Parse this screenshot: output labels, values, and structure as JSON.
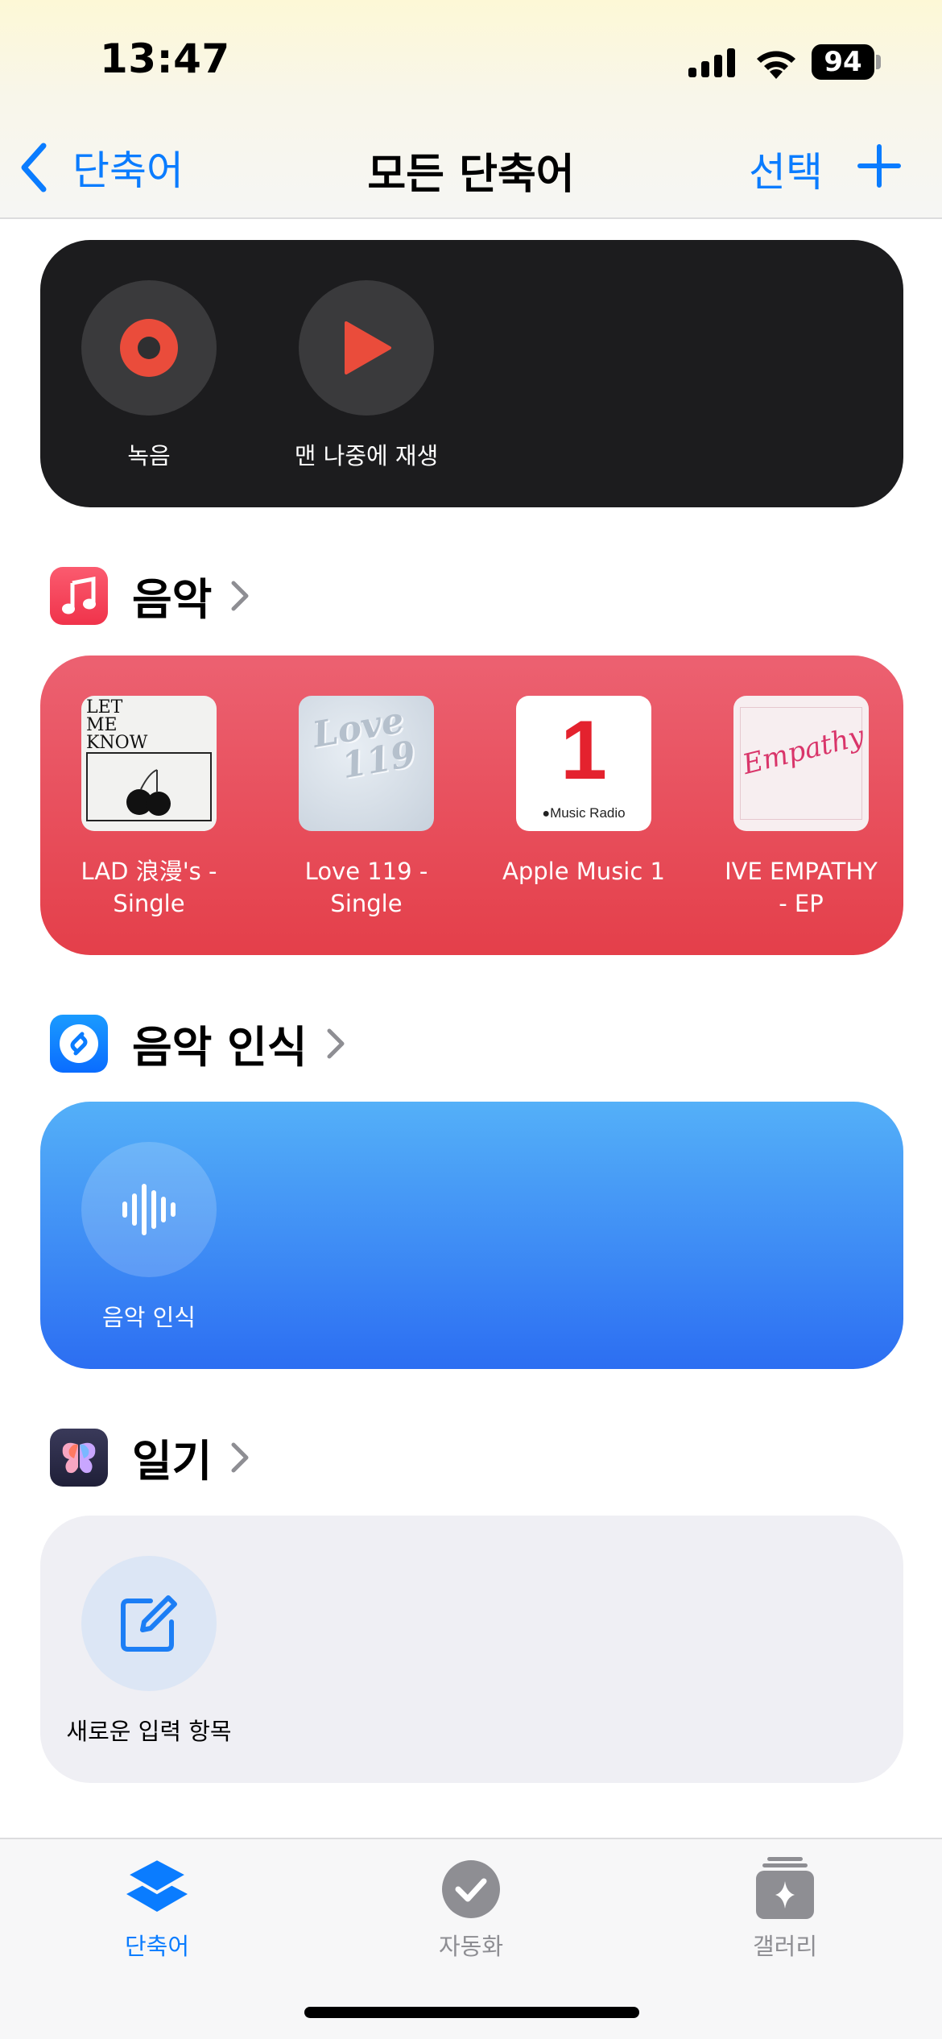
{
  "status_bar": {
    "time": "13:47",
    "battery": "94"
  },
  "nav": {
    "back_label": "단축어",
    "title": "모든 단축어",
    "select_label": "선택"
  },
  "voice_memo_card": {
    "items": [
      {
        "label": "녹음",
        "icon": "record-icon"
      },
      {
        "label": "맨 나중에 재생",
        "icon": "play-icon"
      }
    ]
  },
  "music_section": {
    "title": "음악",
    "items": [
      {
        "line1": "LAD 浪漫's -",
        "line2": "Single",
        "art_text": [
          "LET",
          "ME",
          "KNOW"
        ]
      },
      {
        "line1": "Love 119 -",
        "line2": "Single",
        "art_text": [
          "Love",
          "119"
        ]
      },
      {
        "line1": "Apple Music 1",
        "line2": "",
        "art_number": "1",
        "art_caption": "Music Radio"
      },
      {
        "line1": "IVE EMPATHY",
        "line2": "- EP",
        "art_text": [
          "Empathy"
        ]
      }
    ],
    "accent": "#e84a56"
  },
  "shazam_section": {
    "title": "음악 인식",
    "items": [
      {
        "label": "음악 인식",
        "icon": "waveform-icon"
      }
    ],
    "accent": "#2f7af5"
  },
  "journal_section": {
    "title": "일기",
    "items": [
      {
        "label": "새로운 입력 항목",
        "icon": "compose-icon"
      }
    ]
  },
  "tabbar": {
    "tabs": [
      {
        "label": "단축어",
        "active": true
      },
      {
        "label": "자동화",
        "active": false
      },
      {
        "label": "갤러리",
        "active": false
      }
    ],
    "active_color": "#0a7cff",
    "inactive_color": "#8e8e93"
  }
}
